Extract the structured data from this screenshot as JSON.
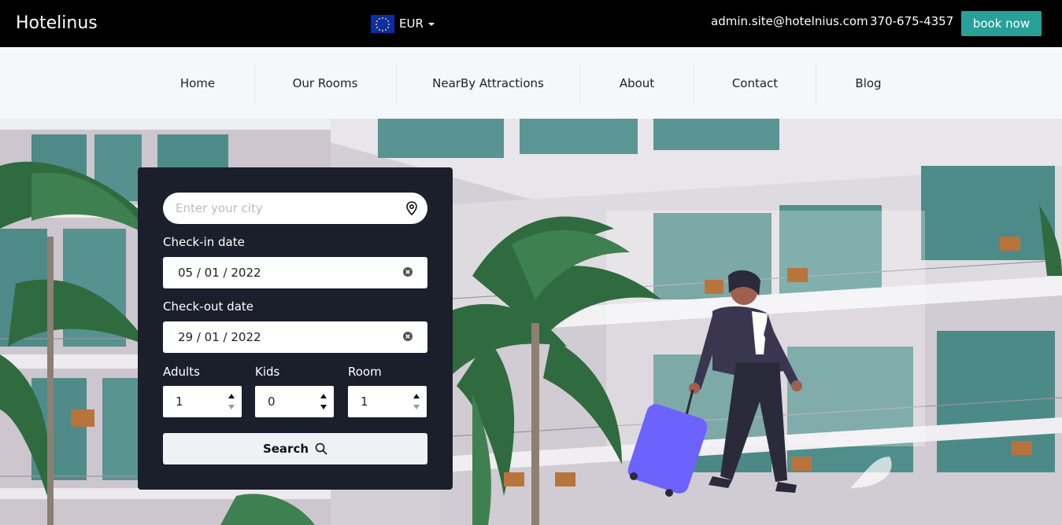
{
  "header": {
    "brand": "Hotelinus",
    "currency": {
      "label": "EUR",
      "flag_icon": "eu-flag-icon"
    },
    "email": "admin.site@hotelnius.com",
    "phone": "370-675-4357",
    "book_label": "book now",
    "book_color": "#27a098"
  },
  "nav": {
    "items": [
      "Home",
      "Our Rooms",
      "NearBy Attractions",
      "About",
      "Contact",
      "Blog"
    ]
  },
  "search": {
    "city_placeholder": "Enter your city",
    "city_value": "",
    "checkin_label": "Check-in date",
    "checkin_value": "05 / 01 / 2022",
    "checkout_label": "Check-out date",
    "checkout_value": "29 / 01 / 2022",
    "adults_label": "Adults",
    "adults_value": "1",
    "kids_label": "Kids",
    "kids_value": "0",
    "room_label": "Room",
    "room_value": "1",
    "search_label": "Search"
  },
  "colors": {
    "topbar": "#000000",
    "navbar": "#f4f8fb",
    "panel": "#1b1f2c",
    "accent": "#27a098",
    "suitcase": "#6c63ff"
  }
}
